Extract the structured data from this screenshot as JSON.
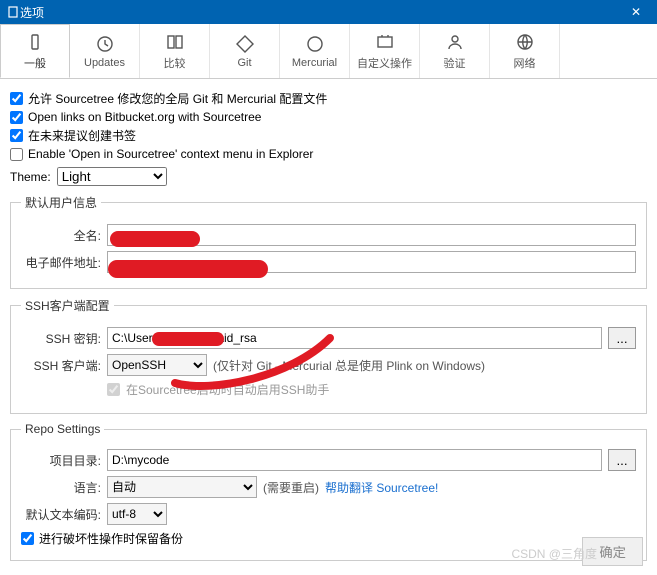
{
  "window": {
    "title": "选项"
  },
  "tabs": [
    {
      "label": "一般"
    },
    {
      "label": "Updates"
    },
    {
      "label": "比较"
    },
    {
      "label": "Git"
    },
    {
      "label": "Mercurial"
    },
    {
      "label": "自定义操作"
    },
    {
      "label": "验证"
    },
    {
      "label": "网络"
    }
  ],
  "checks": {
    "allow_modify": "允许 Sourcetree 修改您的全局 Git 和 Mercurial 配置文件",
    "open_links": "Open links on Bitbucket.org with Sourcetree",
    "suggest_bookmark": "在未来提议创建书签",
    "context_menu": "Enable 'Open in Sourcetree' context menu in Explorer"
  },
  "theme": {
    "label": "Theme:",
    "value": "Light"
  },
  "user": {
    "legend": "默认用户信息",
    "fullname_label": "全名:",
    "fullname_value": "",
    "email_label": "电子邮件地址:",
    "email_value": ""
  },
  "ssh": {
    "legend": "SSH客户端配置",
    "key_label": "SSH 密钥:",
    "key_value": "C:\\Users\\          \\.ssh\\id_rsa",
    "client_label": "SSH 客户端:",
    "client_value": "OpenSSH",
    "hint": "(仅针对 Git - Mercurial 总是使用 Plink on Windows)",
    "auto_label": "在Sourcetree启动时自动启用SSH助手"
  },
  "repo": {
    "legend": "Repo Settings",
    "dir_label": "项目目录:",
    "dir_value": "D:\\mycode",
    "lang_label": "语言:",
    "lang_value": "自动",
    "restart_hint": "(需要重启)",
    "help_link": "帮助翻译 Sourcetree!",
    "encoding_label": "默认文本编码:",
    "encoding_value": "utf-8",
    "backup_label": "进行破坏性操作时保留备份"
  },
  "footer": {
    "ok": "确定"
  },
  "watermark": "CSDN @三角度"
}
